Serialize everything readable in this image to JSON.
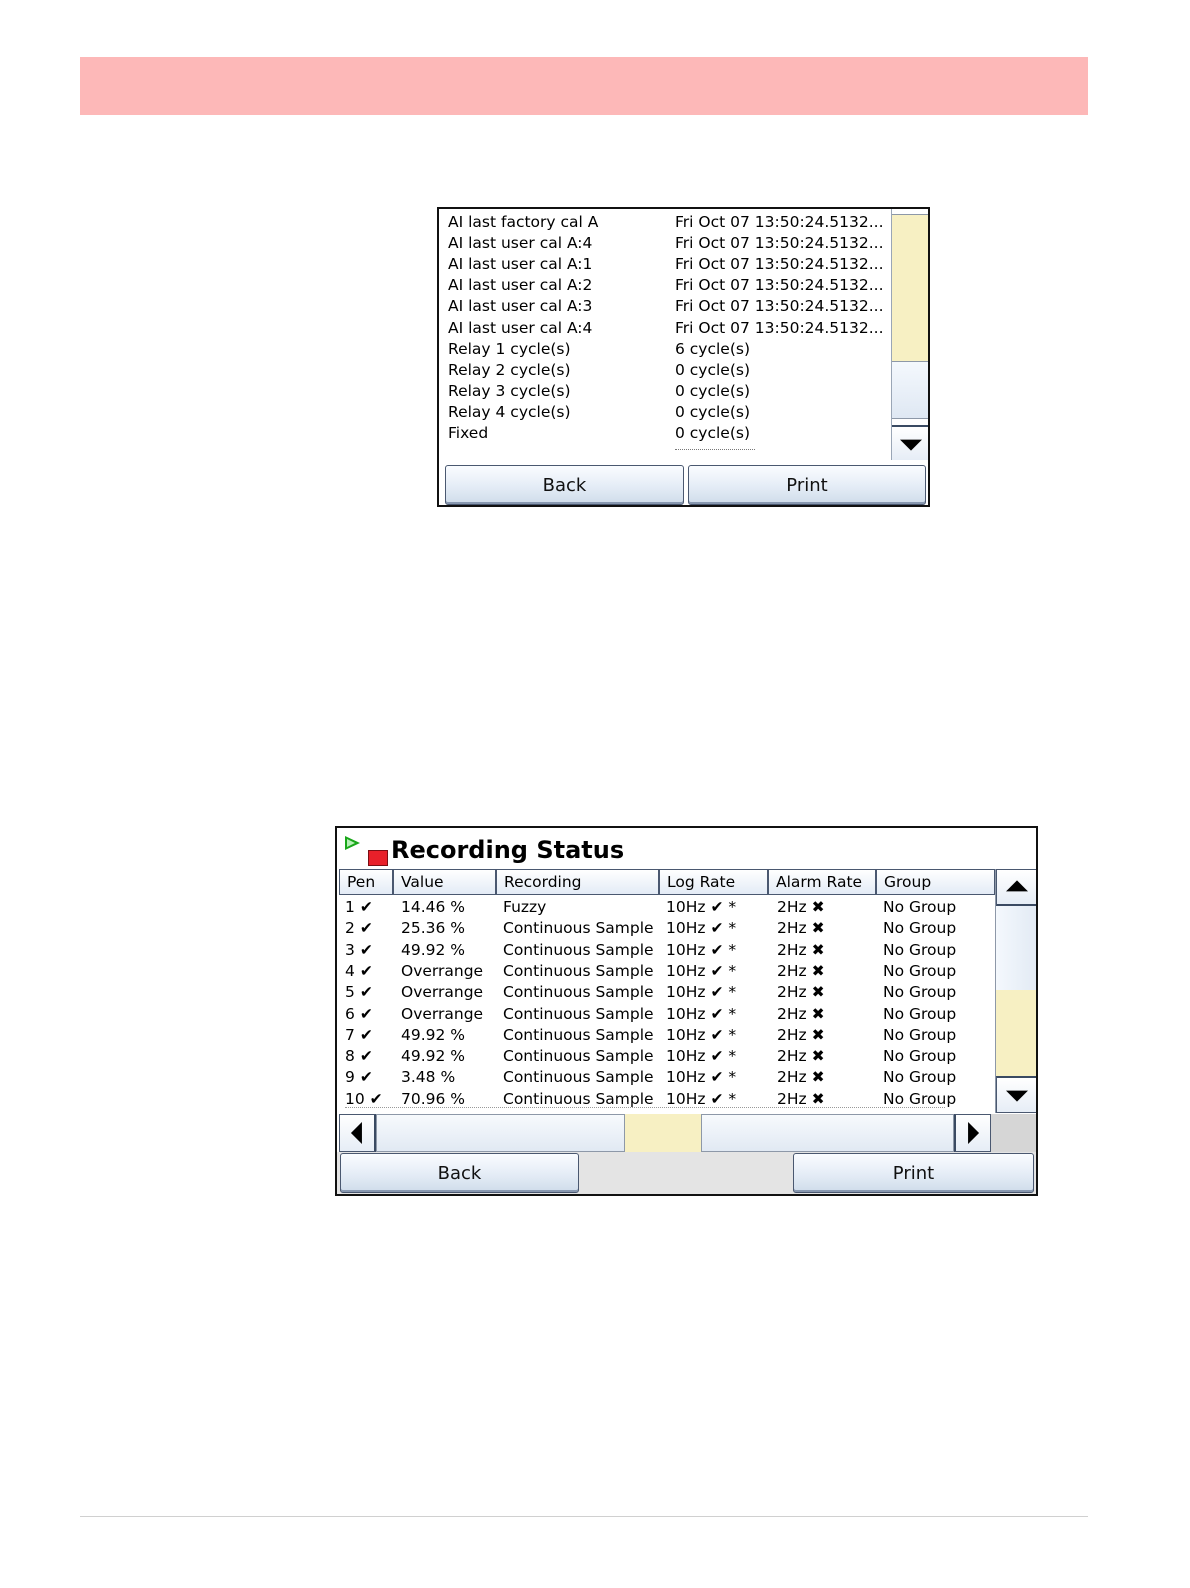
{
  "screen1": {
    "rows": [
      {
        "label": "AI last factory cal A",
        "value": "Fri Oct 07 13:50:24.5132..."
      },
      {
        "label": "AI last user cal A:4",
        "value": "Fri Oct 07 13:50:24.5132..."
      },
      {
        "label": "AI last user cal A:1",
        "value": "Fri Oct 07 13:50:24.5132..."
      },
      {
        "label": "AI last user cal A:2",
        "value": "Fri Oct 07 13:50:24.5132..."
      },
      {
        "label": "AI last user cal A:3",
        "value": "Fri Oct 07 13:50:24.5132..."
      },
      {
        "label": "AI last user cal A:4",
        "value": "Fri Oct 07 13:50:24.5132..."
      },
      {
        "label": "Relay 1 cycle(s)",
        "value": "6 cycle(s)"
      },
      {
        "label": "Relay 2 cycle(s)",
        "value": "0 cycle(s)"
      },
      {
        "label": "Relay 3 cycle(s)",
        "value": "0 cycle(s)"
      },
      {
        "label": "Relay 4 cycle(s)",
        "value": "0 cycle(s)"
      },
      {
        "label": "Fixed",
        "value": "0 cycle(s)"
      }
    ],
    "back_label": "Back",
    "print_label": "Print"
  },
  "screen2": {
    "title": "Recording Status",
    "columns": [
      "Pen",
      "Value",
      "Recording",
      "Log Rate",
      "Alarm Rate",
      "Group"
    ],
    "rows": [
      {
        "pen": "1",
        "value": "14.46 %",
        "recording": "Fuzzy",
        "log_rate": "10Hz",
        "alarm_rate": "2Hz",
        "group": "No Group"
      },
      {
        "pen": "2",
        "value": "25.36 %",
        "recording": "Continuous Sample",
        "log_rate": "10Hz",
        "alarm_rate": "2Hz",
        "group": "No Group"
      },
      {
        "pen": "3",
        "value": "49.92 %",
        "recording": "Continuous Sample",
        "log_rate": "10Hz",
        "alarm_rate": "2Hz",
        "group": "No Group"
      },
      {
        "pen": "4",
        "value": "Overrange",
        "recording": "Continuous Sample",
        "log_rate": "10Hz",
        "alarm_rate": "2Hz",
        "group": "No Group"
      },
      {
        "pen": "5",
        "value": "Overrange",
        "recording": "Continuous Sample",
        "log_rate": "10Hz",
        "alarm_rate": "2Hz",
        "group": "No Group"
      },
      {
        "pen": "6",
        "value": "Overrange",
        "recording": "Continuous Sample",
        "log_rate": "10Hz",
        "alarm_rate": "2Hz",
        "group": "No Group"
      },
      {
        "pen": "7",
        "value": "49.92 %",
        "recording": "Continuous Sample",
        "log_rate": "10Hz",
        "alarm_rate": "2Hz",
        "group": "No Group"
      },
      {
        "pen": "8",
        "value": "49.92 %",
        "recording": "Continuous Sample",
        "log_rate": "10Hz",
        "alarm_rate": "2Hz",
        "group": "No Group"
      },
      {
        "pen": "9",
        "value": "3.48 %",
        "recording": "Continuous Sample",
        "log_rate": "10Hz",
        "alarm_rate": "2Hz",
        "group": "No Group"
      },
      {
        "pen": "10",
        "value": "70.96 %",
        "recording": "Continuous Sample",
        "log_rate": "10Hz",
        "alarm_rate": "2Hz",
        "group": "No Group"
      }
    ],
    "pen_mark": "✔",
    "log_mark": "✔",
    "log_suffix": "*",
    "alarm_mark": "✖",
    "back_label": "Back",
    "print_label": "Print",
    "icons": {
      "running": "play-icon",
      "stopped": "stop-icon"
    }
  }
}
